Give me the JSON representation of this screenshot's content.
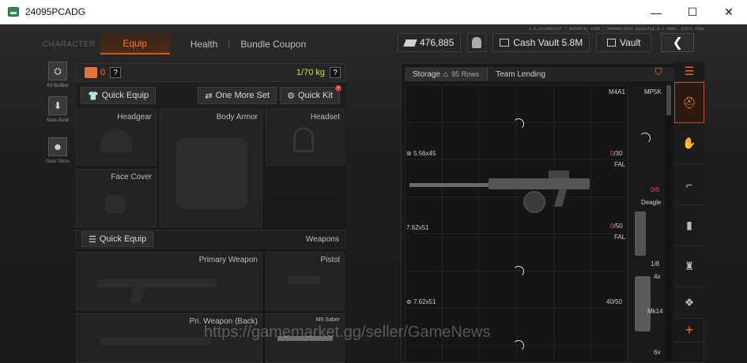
{
  "window": {
    "title": "24095PCADG",
    "minimize": "—",
    "maximize": "☐",
    "close": "✕"
  },
  "debug_text": "1.0.23(2961127 / 0424074) 1F0X / 240906(206) Quality1.0 | 1080, 1C6/1.1fps",
  "tabs": {
    "character": "CHARACTER",
    "equip": "Equip",
    "health": "Health",
    "bundle": "Bundle Coupon"
  },
  "currency": {
    "money": "476,885",
    "cash_vault": "Cash Vault 5.8M",
    "vault": "Vault"
  },
  "rail": [
    {
      "label": "Kit Builder",
      "icon": "kit-builder-icon"
    },
    {
      "label": "Save Build",
      "icon": "save-build-icon"
    },
    {
      "label": "Gear Skins",
      "icon": "gear-skins-icon"
    }
  ],
  "equip": {
    "bag_count": "0",
    "help": "?",
    "weight": "1/70 kg",
    "quick_equip": "Quick Equip",
    "one_more_set": "One More Set",
    "quick_kit": "Quick Kit",
    "quick_kit_badge": "0",
    "slots": {
      "headgear": "Headgear",
      "body_armor": "Body Armor",
      "headset": "Headset",
      "face_cover": "Face Cover"
    },
    "weapons_bar": {
      "quick_equip": "Quick Equip",
      "label": "Weapons"
    },
    "weapon_slots": {
      "primary": "Primary Weapon",
      "pistol": "Pistol",
      "pri_back": "Pri. Weapon (Back)",
      "melee": "M9 Saber"
    }
  },
  "storage": {
    "tab_storage": "Storage",
    "rows": "95 Rows",
    "tab_team": "Team Lending",
    "items": [
      {
        "name": "M4A1",
        "ammo_type": "5.56x45",
        "ammo": "0",
        "ammo_max": "/30"
      },
      {
        "name": "FAL",
        "ammo_type": "7.62x51",
        "ammo": "0",
        "ammo_max": "/50"
      },
      {
        "name": "FAL",
        "ammo_type": "7.62x51",
        "ammo": "40",
        "ammo_max": "/50"
      }
    ],
    "right_items": [
      {
        "name": "MP5K",
        "count": "0/0"
      },
      {
        "name": "Deagle",
        "count": "1/8"
      },
      {
        "name": "Mk14",
        "scope": "4x"
      }
    ],
    "extra": "6x"
  },
  "watermark": "https://gamemarket.gg/seller/GameNews",
  "colors": {
    "accent": "#ff7a2a",
    "weight": "#c3e04a",
    "alert": "#ff4a4a"
  }
}
